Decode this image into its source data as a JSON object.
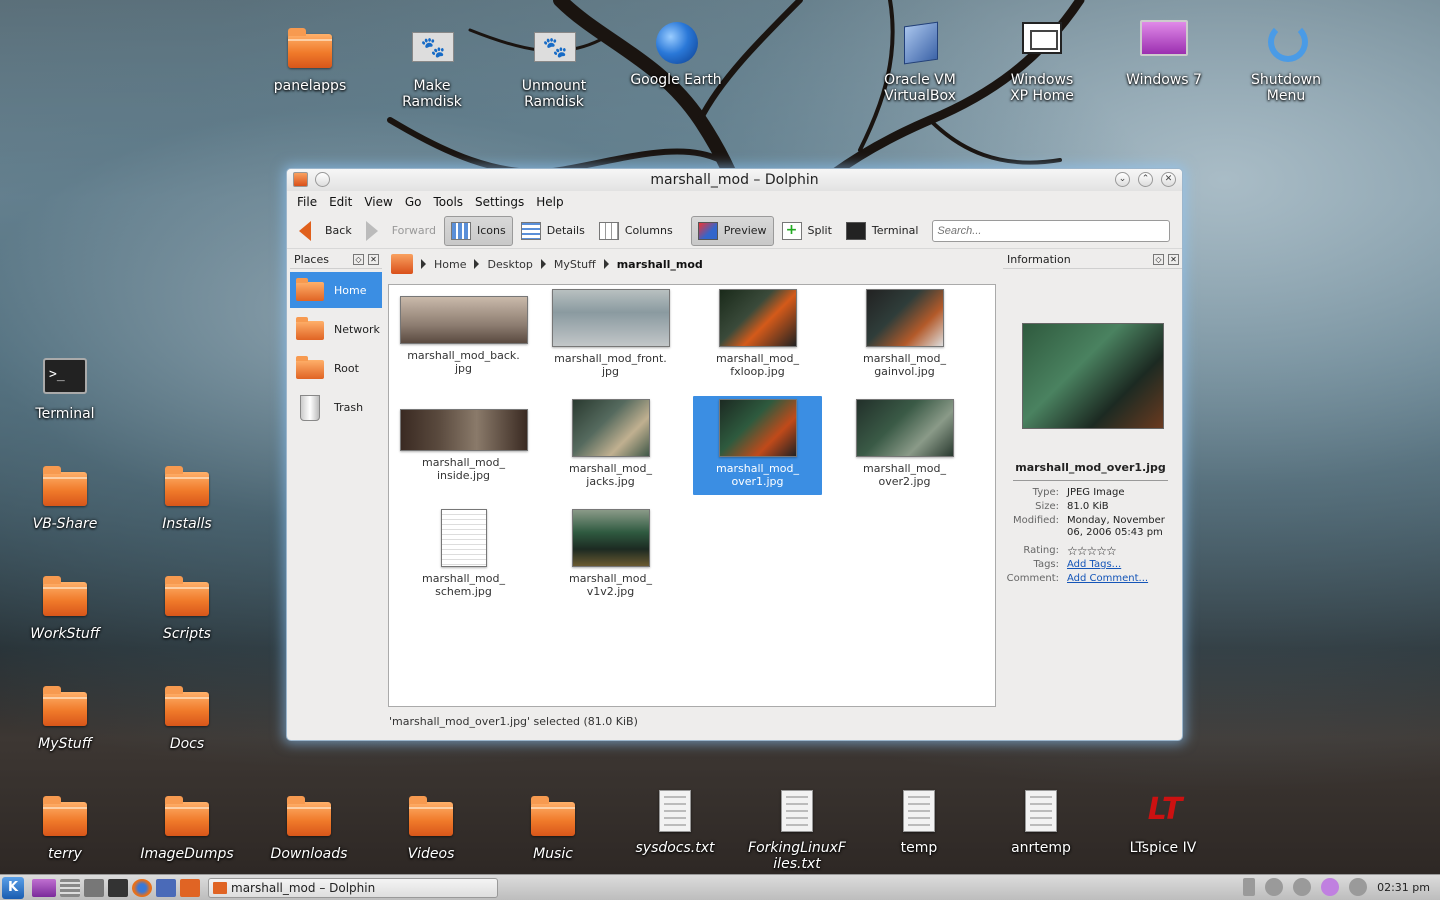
{
  "desktop": {
    "top_icons": [
      {
        "label": "panelapps",
        "icon": "folder-icon"
      },
      {
        "label": "Make Ramdisk",
        "icon": "ramdisk-icon"
      },
      {
        "label": "Unmount Ramdisk",
        "icon": "ramdisk-icon"
      },
      {
        "label": "Google Earth",
        "icon": "google-earth-icon"
      },
      {
        "label": "Oracle VM VirtualBox",
        "icon": "virtualbox-icon"
      },
      {
        "label": "Windows XP Home",
        "icon": "monitor-icon"
      },
      {
        "label": "Windows 7",
        "icon": "monitor-icon"
      },
      {
        "label": "Shutdown Menu",
        "icon": "shutdown-icon"
      }
    ],
    "left_icons": {
      "terminal": "Terminal",
      "vbshare": "VB-Share",
      "installs": "Installs",
      "workstuff": "WorkStuff",
      "scripts": "Scripts",
      "mystuff": "MyStuff",
      "docs": "Docs"
    },
    "bottom_icons": [
      {
        "label": "terry",
        "icon": "folder-icon"
      },
      {
        "label": "ImageDumps",
        "icon": "folder-icon"
      },
      {
        "label": "Downloads",
        "icon": "folder-icon"
      },
      {
        "label": "Videos",
        "icon": "folder-icon"
      },
      {
        "label": "Music",
        "icon": "folder-icon"
      },
      {
        "label": "sysdocs.txt",
        "icon": "text-file-icon"
      },
      {
        "label": "ForkingLinuxFiles.txt",
        "icon": "text-file-icon"
      },
      {
        "label": "temp",
        "icon": "text-file-icon"
      },
      {
        "label": "anrtemp",
        "icon": "text-file-icon"
      },
      {
        "label": "LTspice IV",
        "icon": "ltspice-icon"
      }
    ]
  },
  "window": {
    "title": "marshall_mod – Dolphin",
    "menu": [
      "File",
      "Edit",
      "View",
      "Go",
      "Tools",
      "Settings",
      "Help"
    ],
    "toolbar": {
      "back": "Back",
      "forward": "Forward",
      "icons": "Icons",
      "details": "Details",
      "columns": "Columns",
      "preview": "Preview",
      "split": "Split",
      "terminal": "Terminal"
    },
    "search_placeholder": "Search...",
    "places": {
      "title": "Places",
      "items": [
        "Home",
        "Network",
        "Root",
        "Trash"
      ]
    },
    "breadcrumb": [
      "Home",
      "Desktop",
      "MyStuff",
      "marshall_mod"
    ],
    "files": [
      {
        "name": "marshall_mod_back.\njpg",
        "thumb": "#8e7e72"
      },
      {
        "name": "marshall_mod_front.\njpg",
        "thumb": "#8a9aa0"
      },
      {
        "name": "marshall_mod_\nfxloop.jpg",
        "thumb": "#3a4a3a"
      },
      {
        "name": "marshall_mod_\ngainvol.jpg",
        "thumb": "#2f3d3a"
      },
      {
        "name": "marshall_mod_\ninside.jpg",
        "thumb": "#5a4a3e"
      },
      {
        "name": "marshall_mod_\njacks.jpg",
        "thumb": "#556a5e"
      },
      {
        "name": "marshall_mod_\nover1.jpg",
        "thumb": "#2e5a3e"
      },
      {
        "name": "marshall_mod_\nover2.jpg",
        "thumb": "#3a5a46"
      },
      {
        "name": "marshall_mod_\nschem.jpg",
        "thumb": "#f4f4f4"
      },
      {
        "name": "marshall_mod_\nv1v2.jpg",
        "thumb": "#2f5a40"
      }
    ],
    "selected_index": 6,
    "status": "'marshall_mod_over1.jpg' selected (81.0 KiB)",
    "info": {
      "title": "Information",
      "filename": "marshall_mod_over1.jpg",
      "type_label": "Type:",
      "type": "JPEG Image",
      "size_label": "Size:",
      "size": "81.0 KiB",
      "modified_label": "Modified:",
      "modified": "Monday, November 06, 2006 05:43 pm",
      "rating_label": "Rating:",
      "rating_stars": "☆☆☆☆☆",
      "tags_label": "Tags:",
      "tags": "Add Tags...",
      "comment_label": "Comment:",
      "comment": "Add Comment..."
    }
  },
  "taskbar": {
    "start_label": "K",
    "task_title": "marshall_mod – Dolphin",
    "clock": "02:31 pm"
  }
}
